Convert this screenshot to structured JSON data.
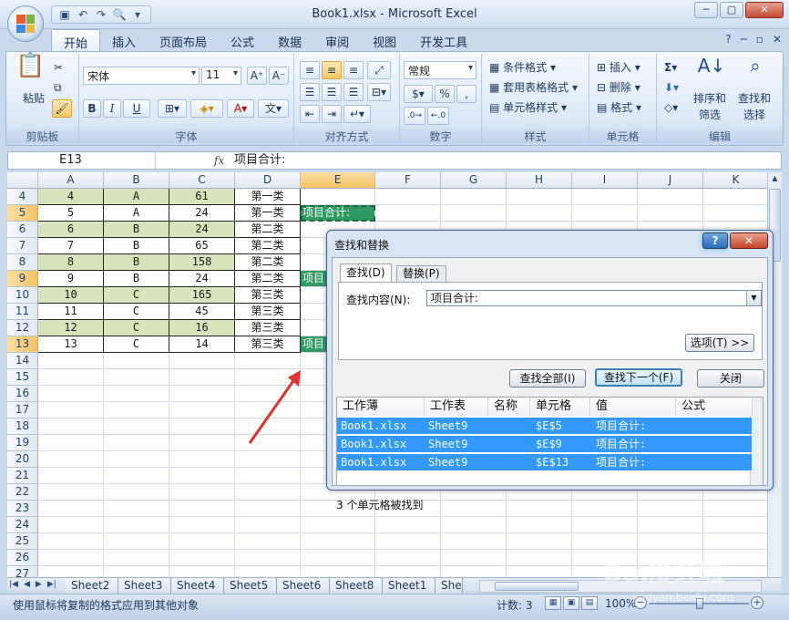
{
  "window": {
    "title": "Book1.xlsx - Microsoft Excel"
  },
  "tabs": [
    "开始",
    "插入",
    "页面布局",
    "公式",
    "数据",
    "审阅",
    "视图",
    "开发工具"
  ],
  "ribbon": {
    "clipboard": {
      "paste": "粘贴",
      "label": "剪贴板"
    },
    "font": {
      "name": "宋体",
      "size": "11",
      "label": "字体",
      "bold": "B",
      "italic": "I",
      "underline": "U"
    },
    "align": {
      "label": "对齐方式"
    },
    "number": {
      "format": "常规",
      "percent": "%",
      "comma": ",",
      "label": "数字"
    },
    "styles": {
      "cond": "条件格式",
      "table": "套用表格格式",
      "cell": "单元格样式",
      "label": "样式"
    },
    "cells": {
      "insert": "插入",
      "delete": "删除",
      "format": "格式",
      "label": "单元格"
    },
    "editing": {
      "sort": "排序和\n筛选",
      "sort1": "排序和",
      "sort2": "筛选",
      "find1": "查找和",
      "find2": "选择",
      "label": "编辑"
    }
  },
  "formula_bar": {
    "name_box": "E13",
    "fx": "fx",
    "content": "项目合计:"
  },
  "columns": [
    "A",
    "B",
    "C",
    "D",
    "E",
    "F",
    "G",
    "H",
    "I",
    "J",
    "K"
  ],
  "rows": [
    {
      "n": "4",
      "a": "4",
      "b": "A",
      "c": "61",
      "d": "第一类"
    },
    {
      "n": "5",
      "a": "5",
      "b": "A",
      "c": "24",
      "d": "第一类",
      "e": "项目合计:"
    },
    {
      "n": "6",
      "a": "6",
      "b": "B",
      "c": "24",
      "d": "第二类"
    },
    {
      "n": "7",
      "a": "7",
      "b": "B",
      "c": "65",
      "d": "第二类"
    },
    {
      "n": "8",
      "a": "8",
      "b": "B",
      "c": "158",
      "d": "第二类"
    },
    {
      "n": "9",
      "a": "9",
      "b": "B",
      "c": "24",
      "d": "第二类",
      "e": "项目"
    },
    {
      "n": "10",
      "a": "10",
      "b": "C",
      "c": "165",
      "d": "第三类"
    },
    {
      "n": "11",
      "a": "11",
      "b": "C",
      "c": "45",
      "d": "第三类"
    },
    {
      "n": "12",
      "a": "12",
      "b": "C",
      "c": "16",
      "d": "第三类"
    },
    {
      "n": "13",
      "a": "13",
      "b": "C",
      "c": "14",
      "d": "第三类",
      "e": "项目"
    }
  ],
  "empty_rows": [
    "14",
    "15",
    "16",
    "17",
    "18",
    "19",
    "20",
    "21",
    "22",
    "23",
    "24",
    "25",
    "26",
    "27"
  ],
  "sheets": [
    "Sheet2",
    "Sheet3",
    "Sheet4",
    "Sheet5",
    "Sheet6",
    "Sheet8",
    "Sheet1",
    "She"
  ],
  "status": {
    "text": "使用鼠标将复制的格式应用到其他对象",
    "count": "计数: 3",
    "zoom": "100%"
  },
  "dialog": {
    "title": "查找和替换",
    "tab_find": "查找(D)",
    "tab_replace": "替换(P)",
    "find_label": "查找内容(N):",
    "find_value": "项目合计:",
    "options": "选项(T) >>",
    "find_all": "查找全部(I)",
    "find_next": "查找下一个(F)",
    "close": "关闭",
    "headers": [
      "工作薄",
      "工作表",
      "名称",
      "单元格",
      "值",
      "公式"
    ],
    "results": [
      {
        "book": "Book1.xlsx",
        "sheet": "Sheet9",
        "cell": "$E$5",
        "value": "项目合计:"
      },
      {
        "book": "Book1.xlsx",
        "sheet": "Sheet9",
        "cell": "$E$9",
        "value": "项目合计:"
      },
      {
        "book": "Book1.xlsx",
        "sheet": "Sheet9",
        "cell": "$E$13",
        "value": "项目合计:"
      }
    ],
    "found_text": "3 个单元格被找到"
  },
  "watermark": {
    "main": "Bai度经验",
    "sub": "jingyan.baidu.com"
  },
  "colors": {
    "found_cell": "#2e9a62",
    "green_row": "#d8e4bc",
    "selection": "#3399ff",
    "arrow": "#e03030"
  }
}
